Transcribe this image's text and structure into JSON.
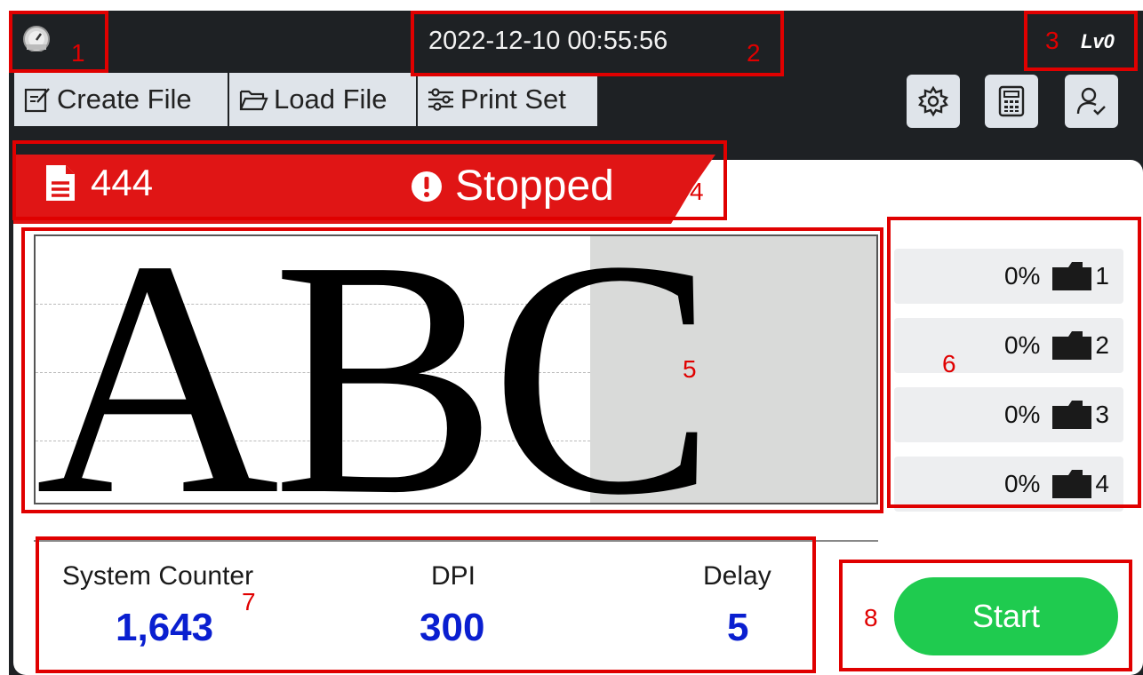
{
  "header": {
    "datetime": "2022-12-10 00:55:56",
    "level": "Lv0"
  },
  "toolbar": {
    "tabs": [
      {
        "label": "Create File",
        "icon": "edit-file-icon"
      },
      {
        "label": "Load File",
        "icon": "folder-open-icon"
      },
      {
        "label": "Print Set",
        "icon": "sliders-icon"
      }
    ],
    "icons": [
      "gear-icon",
      "calculator-icon",
      "user-check-icon"
    ]
  },
  "job": {
    "file_name": "444",
    "status": "Stopped"
  },
  "preview": {
    "text": "ABC"
  },
  "ink_slots": [
    {
      "percent": "0%",
      "number": "1"
    },
    {
      "percent": "0%",
      "number": "2"
    },
    {
      "percent": "0%",
      "number": "3"
    },
    {
      "percent": "0%",
      "number": "4"
    }
  ],
  "stats": {
    "system_counter": {
      "label": "System Counter",
      "value": "1,643"
    },
    "dpi": {
      "label": "DPI",
      "value": "300"
    },
    "delay": {
      "label": "Delay",
      "value": "5"
    }
  },
  "actions": {
    "start_label": "Start"
  },
  "annotations": [
    "1",
    "2",
    "3",
    "4",
    "5",
    "6",
    "7",
    "8"
  ],
  "colors": {
    "background": "#1e2124",
    "banner": "#e01515",
    "start": "#1fcb4f",
    "values": "#0a1fd0",
    "annotation": "#e00000"
  }
}
